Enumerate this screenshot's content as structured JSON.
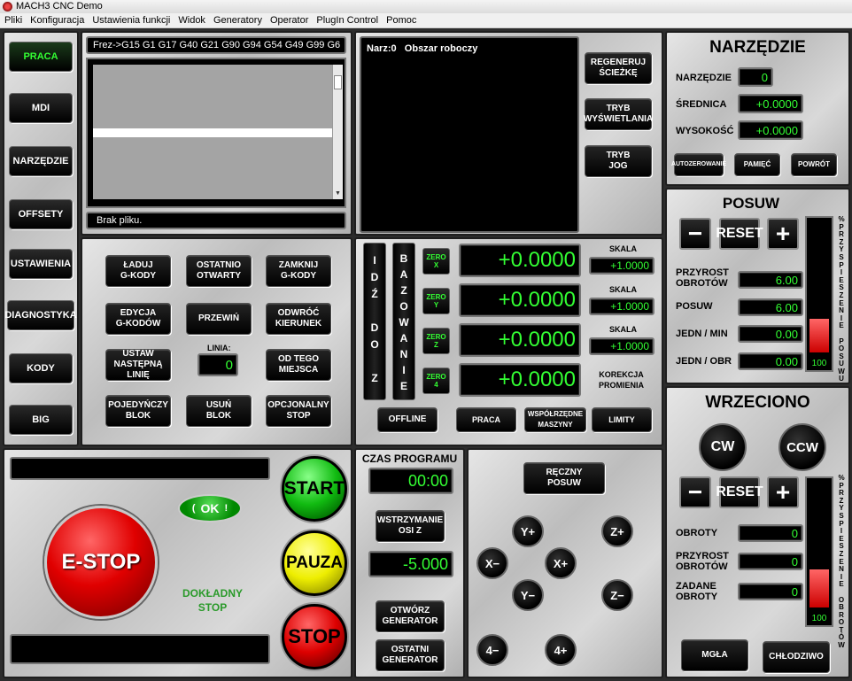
{
  "window": {
    "title": "MACH3 CNC  Demo"
  },
  "menu": [
    "Pliki",
    "Konfiguracja",
    "Ustawienia funkcji",
    "Widok",
    "Generatory",
    "Operator",
    "PlugIn Control",
    "Pomoc"
  ],
  "nav": {
    "praca": "PRACA",
    "mdi": "MDI",
    "narzedzie": "NARZĘDZIE",
    "offsety": "OFFSETY",
    "ustawienia": "USTAWIENIA",
    "diagnostyka": "DIAGNOSTYKA",
    "kody": "KODY",
    "big": "BIG"
  },
  "gcode": {
    "modal": "Frez->G15  G1 G17 G40 G21 G90 G94 G54 G49 G99 G6",
    "status": "Brak pliku."
  },
  "toolpath": {
    "label": "Narz:0   Obszar roboczy",
    "regen": "REGENERUJ\nŚCIEŻKĘ",
    "tryb_wysw": "TRYB\nWYŚWIETLANIA",
    "tryb_jog": "TRYB\nJOG"
  },
  "narzedzie": {
    "title": "NARZĘDZIE",
    "narz_label": "NARZĘDZIE",
    "narz_val": "0",
    "sred_label": "ŚREDNICA",
    "sred_val": "+0.0000",
    "wys_label": "WYSOKOŚĆ",
    "wys_val": "+0.0000",
    "autozero": "AUTOZEROWANIE",
    "pamiec": "PAMIĘĆ",
    "powrot": "POWRÓT"
  },
  "prog": {
    "laduj": "ŁADUJ\nG-KODY",
    "ostatnio": "OSTATNIO\nOTWARTY",
    "zamknij": "ZAMKNIJ\nG-KODY",
    "edycja": "EDYCJA\nG-KODÓW",
    "przewin": "PRZEWIŃ",
    "odwroc": "ODWRÓĆ\nKIERUNEK",
    "ustaw": "USTAW\nNASTĘPNĄ LINIĘ",
    "linia_label": "LINIA:",
    "linia_val": "0",
    "od_tego": "OD TEGO\nMIEJSCA",
    "pojedynczy": "POJEDYŃCZY\nBLOK",
    "usun": "USUŃ\nBLOK",
    "opcjonalny": "OPCJONALNY\nSTOP"
  },
  "dro": {
    "idz": [
      "I",
      "D",
      "Ź",
      "",
      "D",
      "O",
      "",
      "Z"
    ],
    "bazow": [
      "B",
      "A",
      "Z",
      "O",
      "W",
      "A",
      "N",
      "I",
      "E"
    ],
    "zero": [
      "ZERO\nX",
      "ZERO\nY",
      "ZERO\nZ",
      "ZERO\n4"
    ],
    "axes": [
      "+0.0000",
      "+0.0000",
      "+0.0000",
      "+0.0000"
    ],
    "skala_label": "SKALA",
    "skala": [
      "+1.0000",
      "+1.0000",
      "+1.0000"
    ],
    "korekcja": "KOREKCJA\nPROMIENIA",
    "offline": "OFFLINE",
    "praca": "PRACA",
    "wspolrzedne": "WSPÓŁRZĘDNE\nMASZYNY",
    "limity": "LIMITY"
  },
  "posuw": {
    "title": "POSUW",
    "reset": "RESET",
    "minus": "−",
    "plus": "+",
    "przyrost_label": "PRZYROST\nOBROTÓW",
    "przyrost_val": "6.00",
    "posuw_label": "POSUW",
    "posuw_val": "6.00",
    "jedn_min_label": "JEDN / MIN",
    "jedn_min_val": "0.00",
    "jedn_obr_label": "JEDN / OBR",
    "jedn_obr_val": "0.00",
    "bar_val": "100",
    "bar_fraction": 0.26,
    "vertical": [
      "%",
      "P",
      "R",
      "Z",
      "Y",
      "S",
      "P",
      "I",
      "E",
      "S",
      "Z",
      "E",
      "N",
      "I",
      "E",
      "",
      "P",
      "O",
      "S",
      "U",
      "W",
      "U"
    ]
  },
  "wrzeciono": {
    "title": "WRZECIONO",
    "cw": "CW",
    "ccw": "CCW",
    "reset": "RESET",
    "minus": "−",
    "plus": "+",
    "obroty_label": "OBROTY",
    "obroty_val": "0",
    "przyrost_label": "PRZYROST\nOBROTÓW",
    "przyrost_val": "0",
    "zadane_label": "ZADANE\nOBROTY",
    "zadane_val": "0",
    "bar_val": "100",
    "bar_fraction": 0.3,
    "vertical": [
      "%",
      "P",
      "R",
      "Z",
      "Y",
      "S",
      "P",
      "I",
      "E",
      "S",
      "Z",
      "E",
      "N",
      "I",
      "E",
      "",
      "O",
      "B",
      "R",
      "O",
      "T",
      "Ó",
      "W"
    ],
    "mgla": "MGŁA",
    "chlodziwo": "CHŁODZIWO"
  },
  "control": {
    "estop": "E-STOP",
    "ok": "OK",
    "start": "START",
    "pauza": "PAUZA",
    "stop": "STOP",
    "dokladny": "DOKŁADNY\nSTOP"
  },
  "czas": {
    "title": "CZAS PROGRAMU",
    "val": "00:00",
    "wstrzymanie": "WSTRZYMANIE\nOSI Z",
    "wstrz_val": "-5.000",
    "otworz": "OTWÓRZ\nGENERATOR",
    "ostatni": "OSTATNI\nGENERATOR"
  },
  "jog": {
    "reczny": "RĘCZNY\nPOSUW",
    "yplus": "Y+",
    "zplus": "Z+",
    "xminus": "X−",
    "xplus": "X+",
    "yminus": "Y−",
    "zminus": "Z−",
    "aminus": "4−",
    "aplus": "4+"
  }
}
